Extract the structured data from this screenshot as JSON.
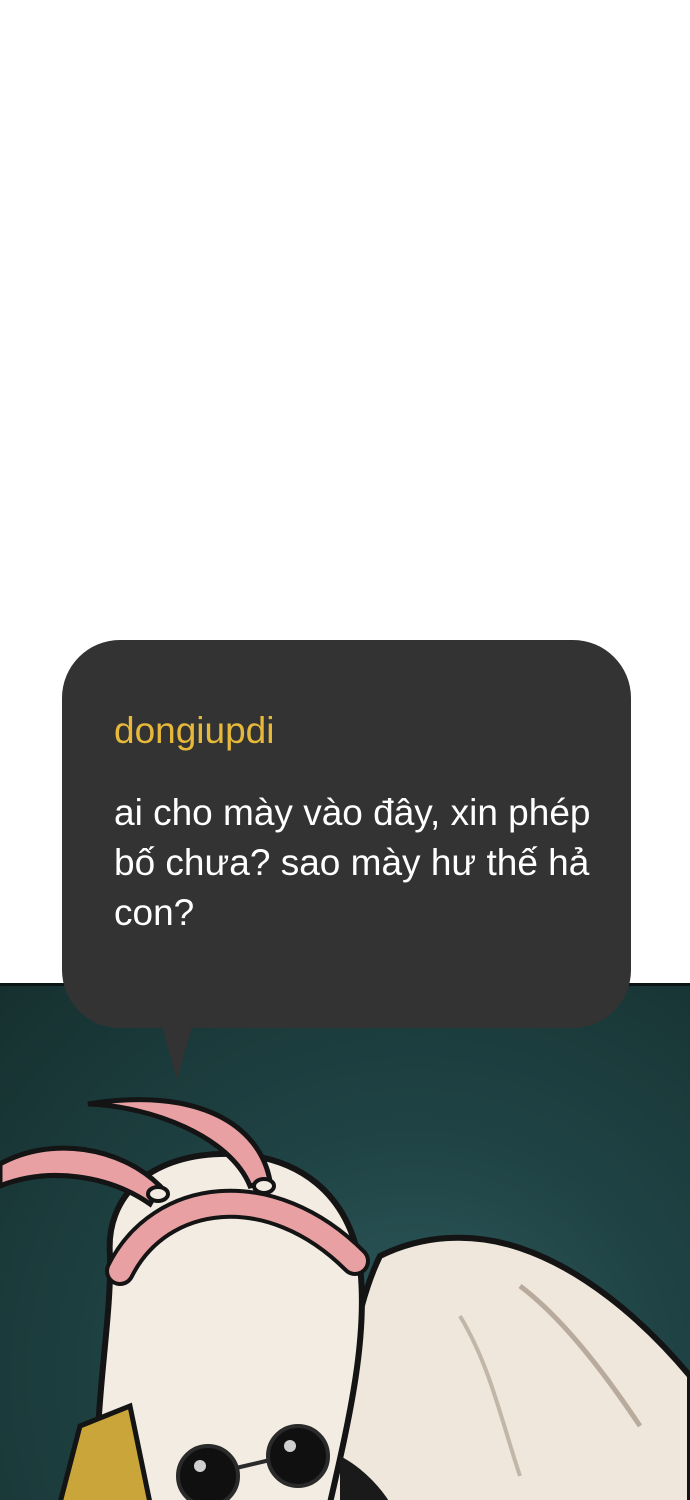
{
  "comment": {
    "username": "dongiupdi",
    "text": "ai cho mày vào đây, xin phép bố chưa? sao mày hư thế hả con?"
  },
  "colors": {
    "bubble": "#333333",
    "username": "#e6b93b",
    "message": "#ffffff",
    "scene_background": "#1f4345",
    "bunny_ears": "#e9a0a2",
    "skin": "#efe9df"
  }
}
